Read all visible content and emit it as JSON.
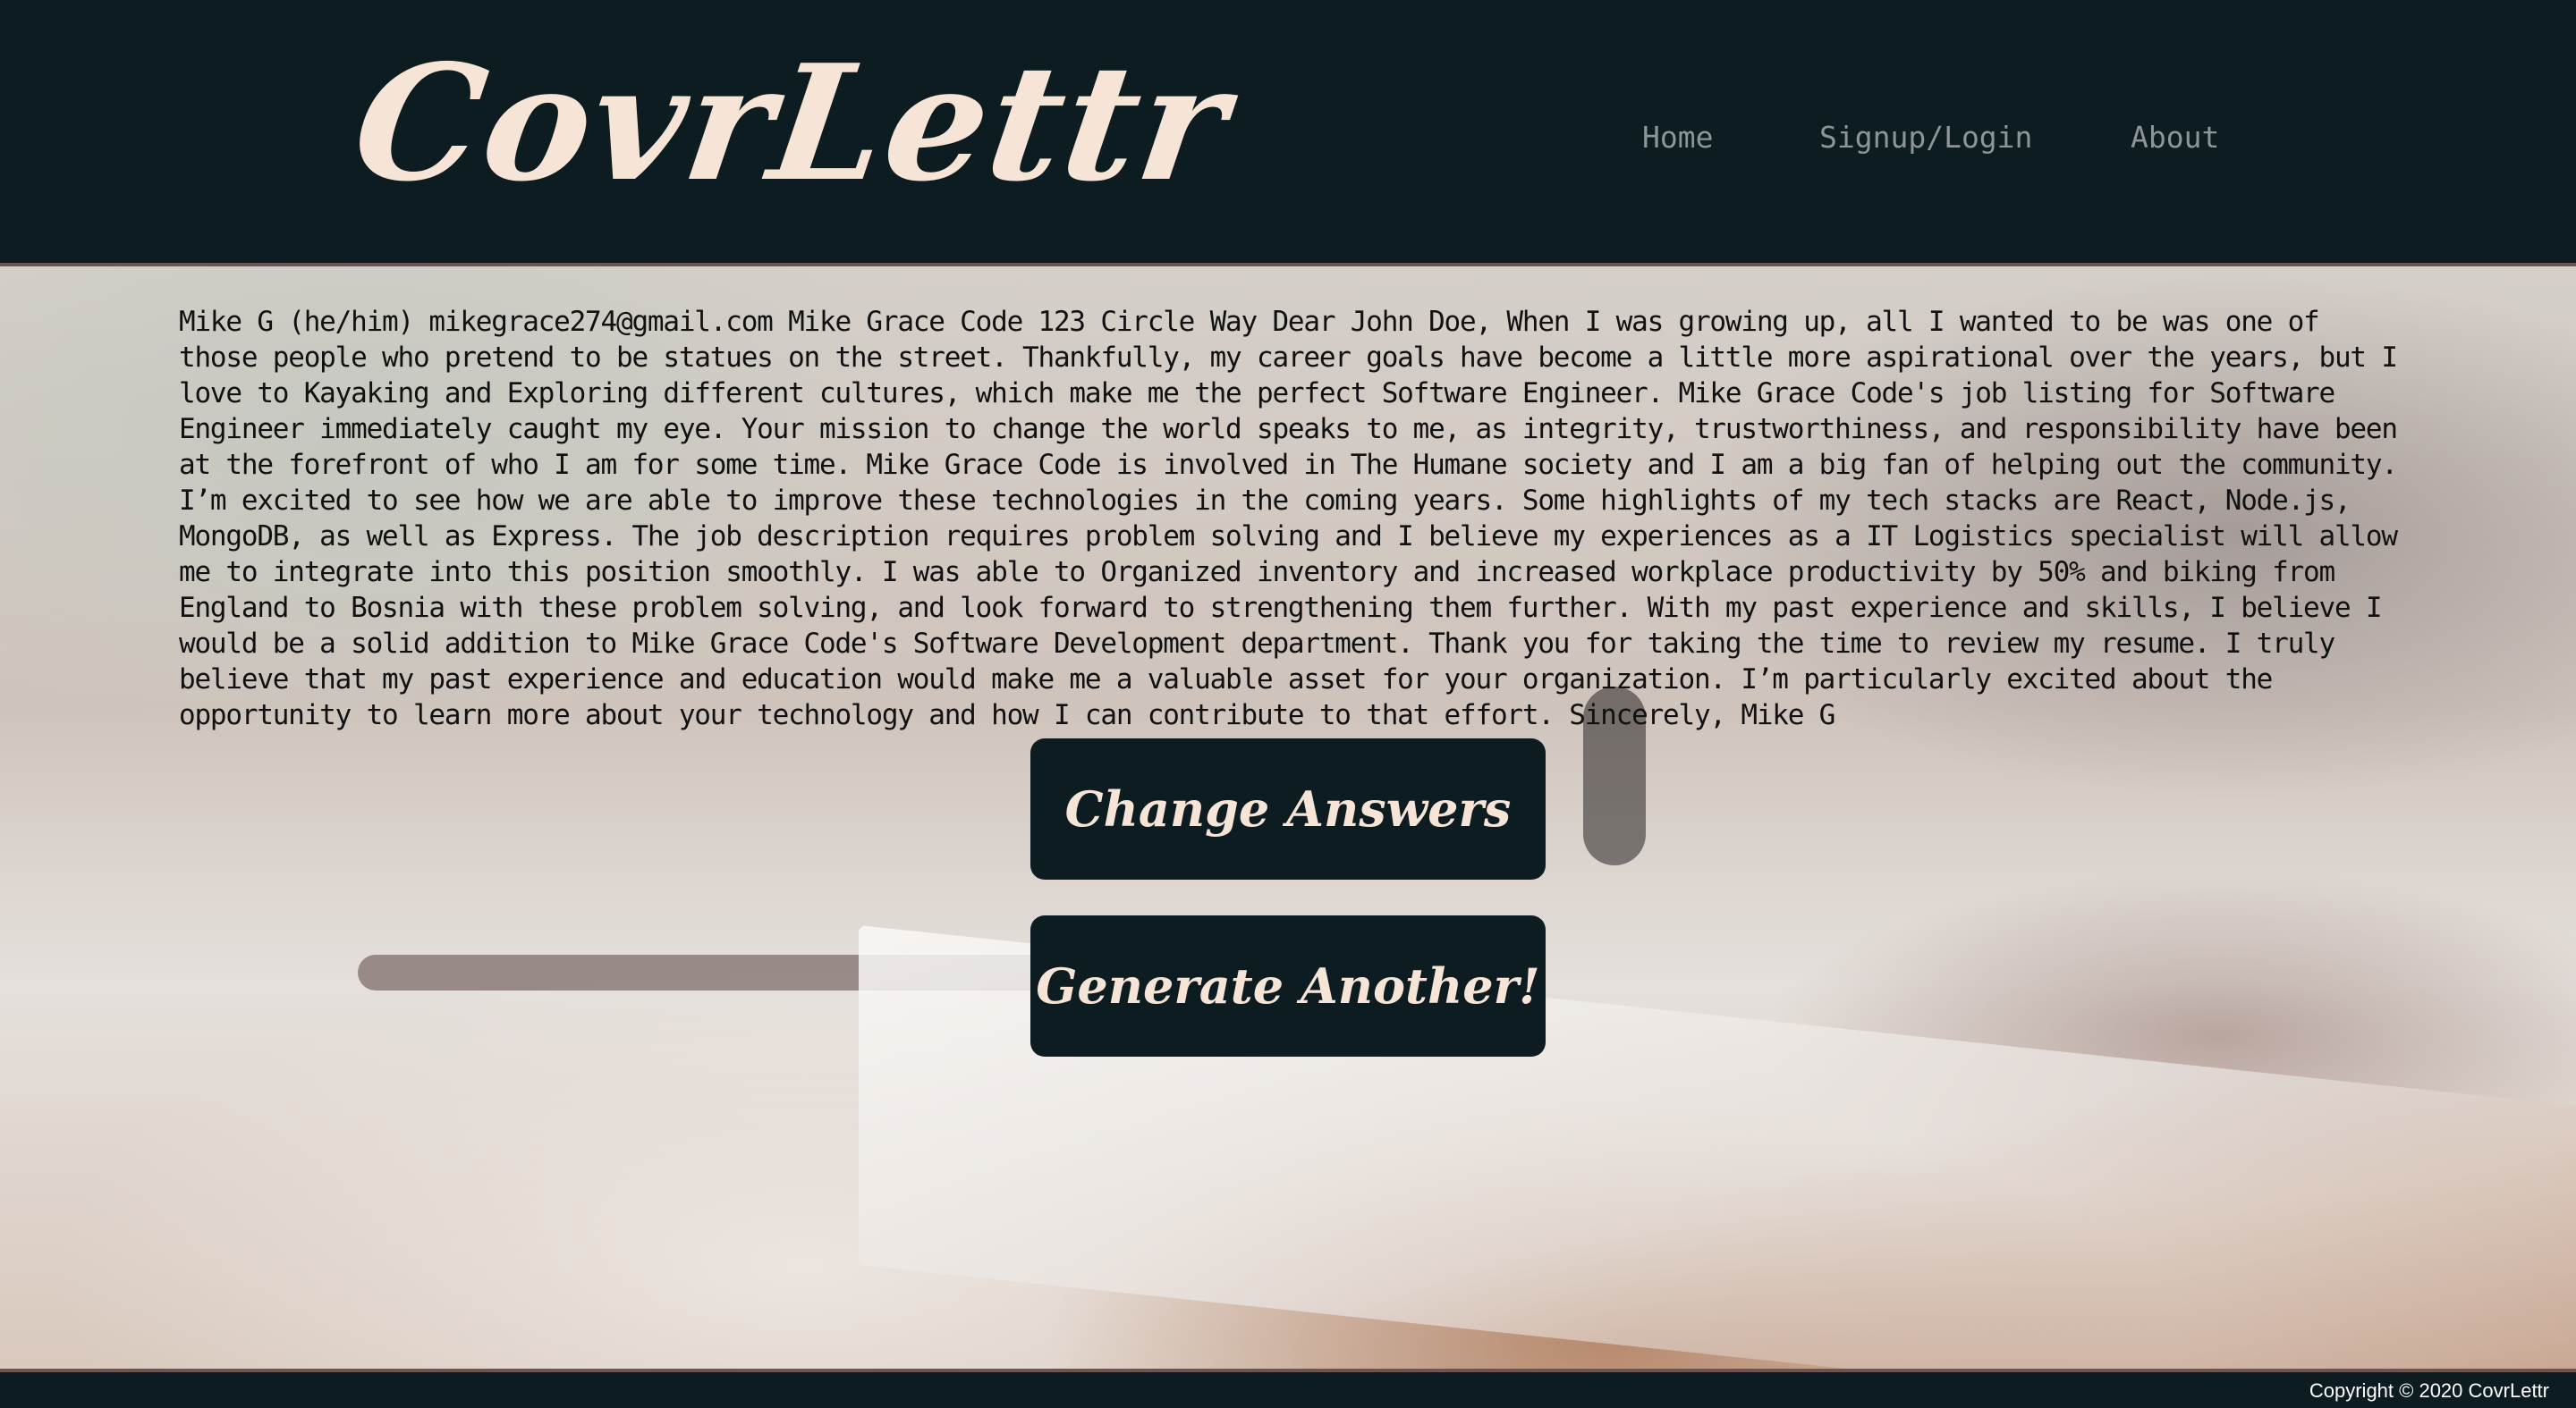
{
  "header": {
    "logo": "CovrLettr",
    "nav": {
      "home": "Home",
      "signup_login": "Signup/Login",
      "about": "About"
    }
  },
  "main": {
    "letter_text": "Mike G (he/him) mikegrace274@gmail.com Mike Grace Code 123 Circle Way Dear John Doe, When I was growing up, all I wanted to be was one of those people who pretend to be statues on the street. Thankfully, my career goals have become a little more aspirational over the years, but I love to Kayaking and Exploring different cultures, which make me the perfect Software Engineer. Mike Grace Code's job listing for Software Engineer immediately caught my eye. Your mission to change the world speaks to me, as integrity, trustworthiness, and responsibility have been at the forefront of who I am for some time. Mike Grace Code is involved in The Humane society and I am a big fan of helping out the community. I’m excited to see how we are able to improve these technologies in the coming years. Some highlights of my tech stacks are React, Node.js, MongoDB, as well as Express. The job description requires problem solving and I believe my experiences as a IT Logistics specialist will allow me to integrate into this position smoothly. I was able to Organized inventory and increased workplace productivity by 50% and biking from England to Bosnia with these problem solving, and look forward to strengthening them further. With my past experience and skills, I believe I would be a solid addition to Mike Grace Code's Software Development department. Thank you for taking the time to review my resume. I truly believe that my past experience and education would make me a valuable asset for your organization. I’m particularly excited about the opportunity to learn more about your technology and how I can contribute to that effort. Sincerely, Mike G",
    "buttons": {
      "change_answers": "Change Answers",
      "generate_another": "Generate Another!"
    }
  },
  "footer": {
    "copyright": "Copyright © 2020 CovrLettr"
  },
  "colors": {
    "header_bg": "#0d1c21",
    "logo": "#f6e4d6",
    "nav_link": "#8d9597",
    "button_bg": "#0d1c21",
    "button_text": "#f6e4d6"
  }
}
